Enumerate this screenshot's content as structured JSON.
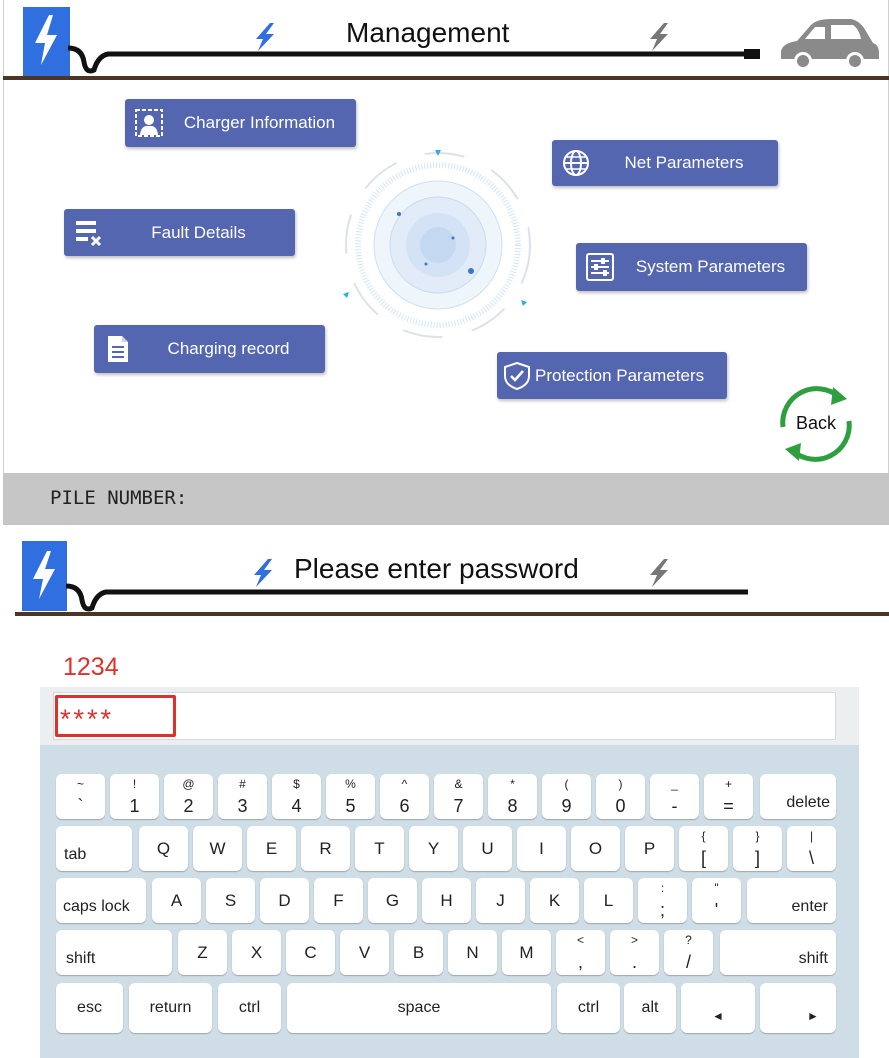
{
  "management": {
    "title": "Management",
    "buttons": [
      {
        "id": "charger-info",
        "label": "Charger Information"
      },
      {
        "id": "net-params",
        "label": "Net Parameters"
      },
      {
        "id": "fault-details",
        "label": "Fault Details"
      },
      {
        "id": "system-params",
        "label": "System Parameters"
      },
      {
        "id": "charging-record",
        "label": "Charging record"
      },
      {
        "id": "protection-params",
        "label": "Protection Parameters"
      }
    ],
    "back_label": "Back",
    "footer_label": "PILE NUMBER:",
    "colors": {
      "button": "#5566b1",
      "back": "#2e9e3e",
      "header_line": "#4a3526",
      "footer": "#c6c6c6"
    }
  },
  "password": {
    "title": "Please enter password",
    "hint": "1234",
    "masked_value": "****"
  },
  "keyboard": {
    "row1": [
      {
        "up": "~",
        "lo": "`"
      },
      {
        "up": "!",
        "lo": "1"
      },
      {
        "up": "@",
        "lo": "2"
      },
      {
        "up": "#",
        "lo": "3"
      },
      {
        "up": "$",
        "lo": "4"
      },
      {
        "up": "%",
        "lo": "5"
      },
      {
        "up": "^",
        "lo": "6"
      },
      {
        "up": "&",
        "lo": "7"
      },
      {
        "up": "*",
        "lo": "8"
      },
      {
        "up": "(",
        "lo": "9"
      },
      {
        "up": ")",
        "lo": "0"
      },
      {
        "up": "_",
        "lo": "-"
      },
      {
        "up": "+",
        "lo": "="
      }
    ],
    "delete": "delete",
    "tab": "tab",
    "row2": [
      "Q",
      "W",
      "E",
      "R",
      "T",
      "Y",
      "U",
      "I",
      "O",
      "P"
    ],
    "row2_sym": [
      {
        "up": "{",
        "lo": "["
      },
      {
        "up": "}",
        "lo": "]"
      },
      {
        "up": "|",
        "lo": "\\"
      }
    ],
    "caps": "caps lock",
    "row3": [
      "A",
      "S",
      "D",
      "F",
      "G",
      "H",
      "J",
      "K",
      "L"
    ],
    "row3_sym": [
      {
        "up": ":",
        "lo": ";"
      },
      {
        "up": "\"",
        "lo": "'"
      }
    ],
    "enter": "enter",
    "shift": "shift",
    "row4": [
      "Z",
      "X",
      "C",
      "V",
      "B",
      "N",
      "M"
    ],
    "row4_sym": [
      {
        "up": "<",
        "lo": ","
      },
      {
        "up": ">",
        "lo": "."
      },
      {
        "up": "?",
        "lo": "/"
      }
    ],
    "esc": "esc",
    "return": "return",
    "ctrl": "ctrl",
    "space": "space",
    "alt": "alt",
    "left_arrow": "◄",
    "right_arrow": "►"
  }
}
